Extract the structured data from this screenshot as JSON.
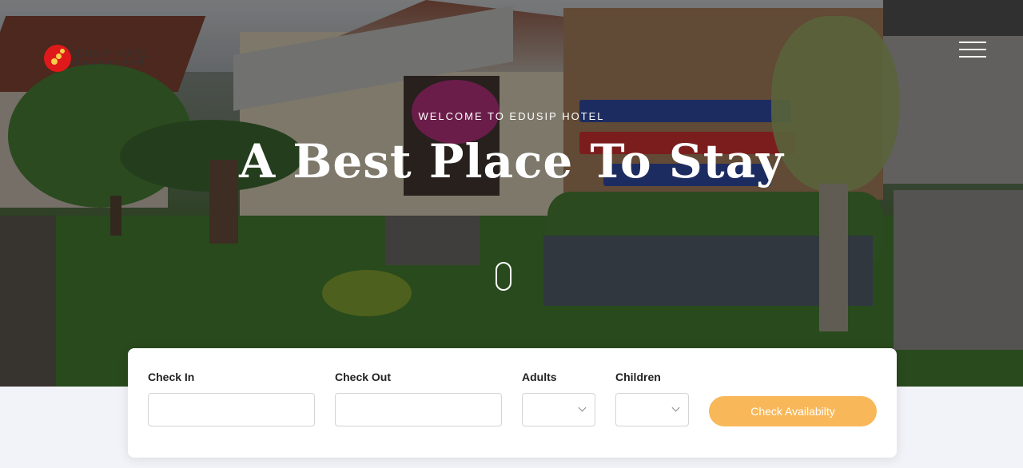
{
  "header": {
    "logo_name": "EDUSIP HOTEL",
    "logo_sub": "educational hotel",
    "menu_icon": "hamburger-menu-icon"
  },
  "hero": {
    "eyebrow": "WELCOME TO EDUSIP HOTEL",
    "headline": "A Best Place To Stay",
    "scroll_icon": "mouse-scroll-icon"
  },
  "booking": {
    "check_in": {
      "label": "Check In",
      "value": "",
      "placeholder": ""
    },
    "check_out": {
      "label": "Check Out",
      "value": "",
      "placeholder": ""
    },
    "adults": {
      "label": "Adults",
      "value": ""
    },
    "children": {
      "label": "Children",
      "value": ""
    },
    "submit_label": "Check Availabilty"
  },
  "colors": {
    "accent": "#f8b85a",
    "logo_red": "#e01a1a",
    "page_bg": "#f2f3f8"
  }
}
